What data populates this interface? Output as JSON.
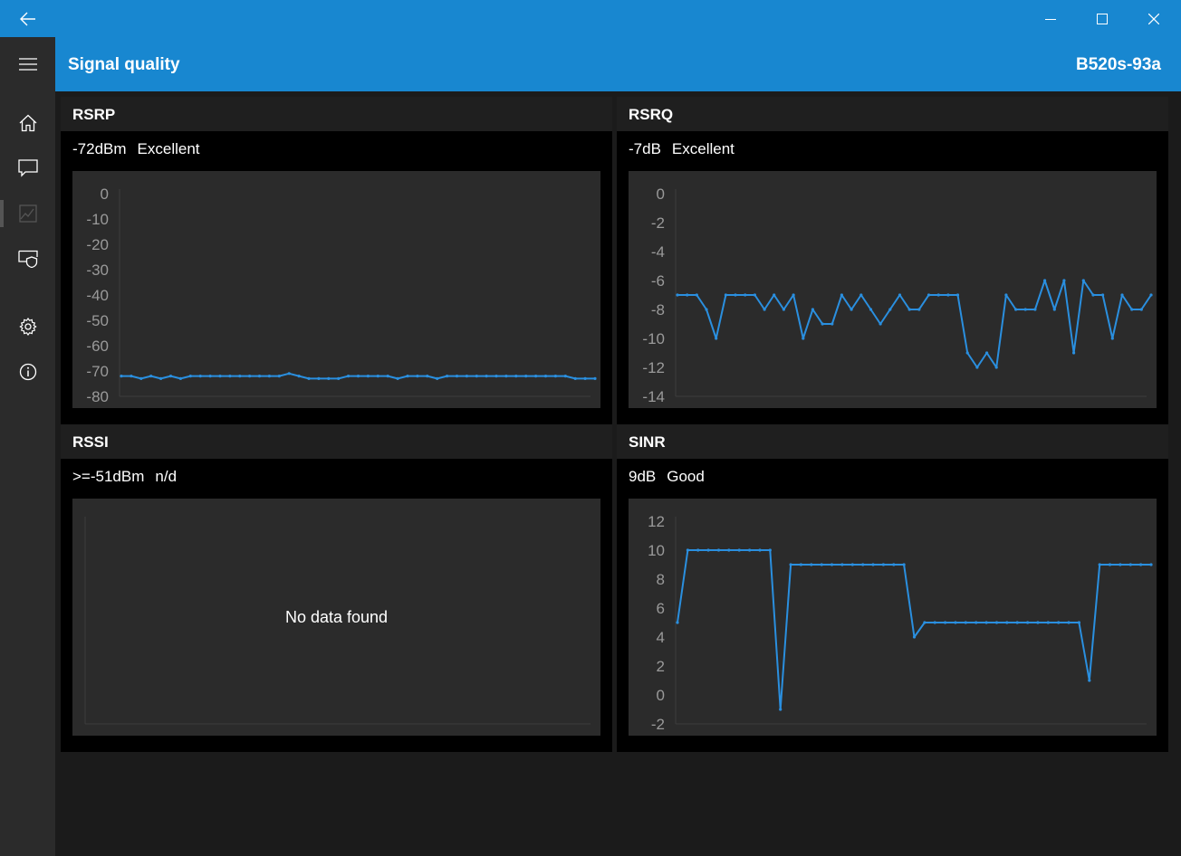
{
  "header": {
    "title": "Signal quality",
    "device": "B520s-93a"
  },
  "colors": {
    "accent": "#1887d0",
    "series": "#2a8fdf",
    "axis_text": "#9a9a9a"
  },
  "nav": {
    "items": [
      {
        "name": "home-icon"
      },
      {
        "name": "message-icon"
      },
      {
        "name": "signal-chart-icon",
        "active": true
      },
      {
        "name": "device-security-icon"
      },
      {
        "name": "gear-icon"
      },
      {
        "name": "info-icon"
      }
    ]
  },
  "panels": {
    "rsrp": {
      "title": "RSRP",
      "value": "-72dBm",
      "quality": "Excellent"
    },
    "rsrq": {
      "title": "RSRQ",
      "value": "-7dB",
      "quality": "Excellent"
    },
    "rssi": {
      "title": "RSSI",
      "value": ">=-51dBm",
      "quality": "n/d",
      "empty_text": "No data found"
    },
    "sinr": {
      "title": "SINR",
      "value": "9dB",
      "quality": "Good"
    }
  },
  "chart_data": [
    {
      "id": "rsrp",
      "type": "line",
      "ylim": [
        -80,
        0
      ],
      "yticks": [
        "0",
        "-10",
        "-20",
        "-30",
        "-40",
        "-50",
        "-60",
        "-70",
        "-80"
      ],
      "values": [
        -72,
        -72,
        -73,
        -72,
        -73,
        -72,
        -73,
        -72,
        -72,
        -72,
        -72,
        -72,
        -72,
        -72,
        -72,
        -72,
        -72,
        -71,
        -72,
        -73,
        -73,
        -73,
        -73,
        -72,
        -72,
        -72,
        -72,
        -72,
        -73,
        -72,
        -72,
        -72,
        -73,
        -72,
        -72,
        -72,
        -72,
        -72,
        -72,
        -72,
        -72,
        -72,
        -72,
        -72,
        -72,
        -72,
        -73,
        -73,
        -73
      ]
    },
    {
      "id": "rsrq",
      "type": "line",
      "ylim": [
        -14,
        0
      ],
      "yticks": [
        "0",
        "-2",
        "-4",
        "-6",
        "-8",
        "-10",
        "-12",
        "-14"
      ],
      "values": [
        -7,
        -7,
        -7,
        -8,
        -10,
        -7,
        -7,
        -7,
        -7,
        -8,
        -7,
        -8,
        -7,
        -10,
        -8,
        -9,
        -9,
        -7,
        -8,
        -7,
        -8,
        -9,
        -8,
        -7,
        -8,
        -8,
        -7,
        -7,
        -7,
        -7,
        -11,
        -12,
        -11,
        -12,
        -7,
        -8,
        -8,
        -8,
        -6,
        -8,
        -6,
        -11,
        -6,
        -7,
        -7,
        -10,
        -7,
        -8,
        -8,
        -7
      ]
    },
    {
      "id": "rssi",
      "type": "line",
      "values": []
    },
    {
      "id": "sinr",
      "type": "line",
      "ylim": [
        -2,
        12
      ],
      "yticks": [
        "12",
        "10",
        "8",
        "6",
        "4",
        "2",
        "0",
        "-2"
      ],
      "values": [
        5,
        10,
        10,
        10,
        10,
        10,
        10,
        10,
        10,
        10,
        -1,
        9,
        9,
        9,
        9,
        9,
        9,
        9,
        9,
        9,
        9,
        9,
        9,
        4,
        5,
        5,
        5,
        5,
        5,
        5,
        5,
        5,
        5,
        5,
        5,
        5,
        5,
        5,
        5,
        5,
        1,
        9,
        9,
        9,
        9,
        9,
        9
      ]
    }
  ]
}
